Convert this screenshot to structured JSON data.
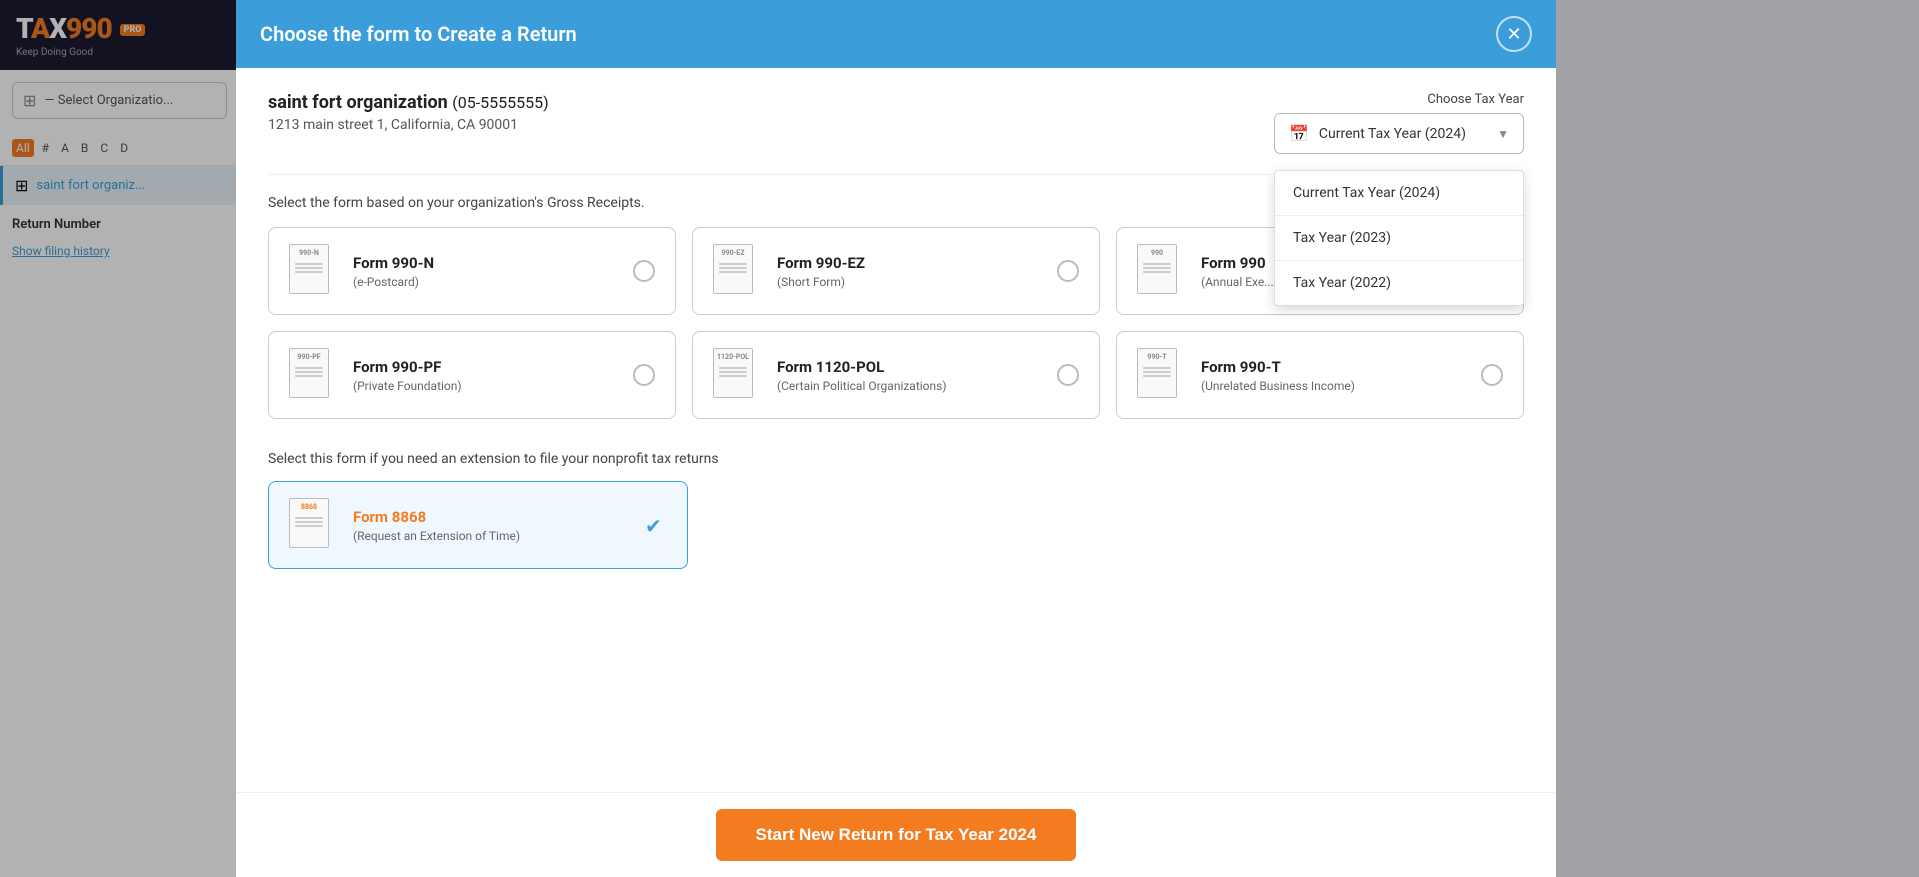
{
  "logo": {
    "tax": "TAX",
    "nine_nine_zero": "990",
    "pro_badge": "PRO",
    "tagline": "Keep Doing Good"
  },
  "sidebar": {
    "org_select_placeholder": "— Select Organizatio...",
    "alpha_items": [
      "All",
      "#",
      "A",
      "B",
      "C",
      "D"
    ],
    "active_alpha": "All",
    "org_item": "saint fort organiz...",
    "return_number_label": "Return Number",
    "show_history_link": "Show filing history"
  },
  "modal": {
    "title": "Choose the form to Create a Return",
    "close_label": "×",
    "org_name": "saint fort organization",
    "org_ein": "(05-5555555)",
    "org_address": "1213 main street 1, California, CA 90001",
    "choose_tax_year_label": "Choose Tax Year",
    "selected_tax_year": "Current Tax Year (2024)",
    "dropdown_options": [
      "Current Tax Year (2024)",
      "Tax Year (2023)",
      "Tax Year (2022)"
    ],
    "section_gross_receipts": "Select the form based on your organization's Gross Receipts.",
    "forms": [
      {
        "badge": "990-N",
        "name": "Form 990-N",
        "desc": "(e-Postcard)",
        "selected": false
      },
      {
        "badge": "990-EZ",
        "name": "Form 990-EZ",
        "desc": "(Short Form)",
        "selected": false
      },
      {
        "badge": "990",
        "name": "Form 990",
        "desc": "(Annual Exe...",
        "selected": false
      },
      {
        "badge": "990-PF",
        "name": "Form 990-PF",
        "desc": "(Private Foundation)",
        "selected": false
      },
      {
        "badge": "1120-POL",
        "name": "Form 1120-POL",
        "desc": "(Certain Political Organizations)",
        "selected": false
      },
      {
        "badge": "990-T",
        "name": "Form 990-T",
        "desc": "(Unrelated Business Income)",
        "selected": false
      }
    ],
    "section_extension": "Select this form if you need an extension to file your nonprofit tax returns",
    "extension_form": {
      "badge": "8868",
      "name": "Form 8868",
      "desc": "(Request an Extension of Time)",
      "selected": true
    },
    "start_button": "Start New Return for Tax Year 2024"
  }
}
